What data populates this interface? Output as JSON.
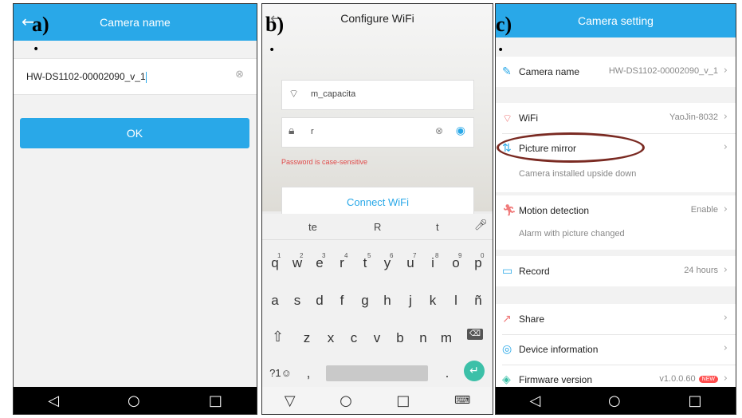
{
  "panels": {
    "a": {
      "label": "a)",
      "title": "Camera name",
      "name_value": "HW-DS1102-00002090_v_1",
      "ok_label": "OK"
    },
    "b": {
      "label": "b)",
      "title": "Configure WiFi",
      "ssid": "m_capacita",
      "password": "r",
      "hint": "Password is case-sensitive",
      "connect_label": "Connect WiFi",
      "suggestions": [
        "te",
        "R",
        "t"
      ],
      "row1": [
        "q",
        "w",
        "e",
        "r",
        "t",
        "y",
        "u",
        "i",
        "o",
        "p"
      ],
      "row1_nums": [
        "1",
        "2",
        "3",
        "4",
        "5",
        "6",
        "7",
        "8",
        "9",
        "0"
      ],
      "row2": [
        "a",
        "s",
        "d",
        "f",
        "g",
        "h",
        "j",
        "k",
        "l",
        "ñ"
      ],
      "row3": [
        "z",
        "x",
        "c",
        "v",
        "b",
        "n",
        "m"
      ],
      "sym_key": "?1☺",
      "comma": ",",
      "period": "."
    },
    "c": {
      "label": "c)",
      "title": "Camera setting",
      "rows": [
        {
          "label": "Camera name",
          "value": "HW-DS1102-00002090_v_1"
        },
        {
          "label": "WiFi",
          "value": "YaoJin-8032"
        },
        {
          "label": "Picture mirror",
          "value": "",
          "sub": "Camera installed upside down"
        },
        {
          "label": "Motion detection",
          "value": "Enable",
          "sub": "Alarm with picture changed"
        },
        {
          "label": "Record",
          "value": "24 hours"
        },
        {
          "label": "Share",
          "value": ""
        },
        {
          "label": "Device information",
          "value": ""
        },
        {
          "label": "Firmware version",
          "value": "v1.0.0.60",
          "badge": "NEW"
        }
      ]
    }
  },
  "colors": {
    "accent": "#29a8e8",
    "highlight_oval": "#7a2a22",
    "hint": "#e04a4a"
  }
}
